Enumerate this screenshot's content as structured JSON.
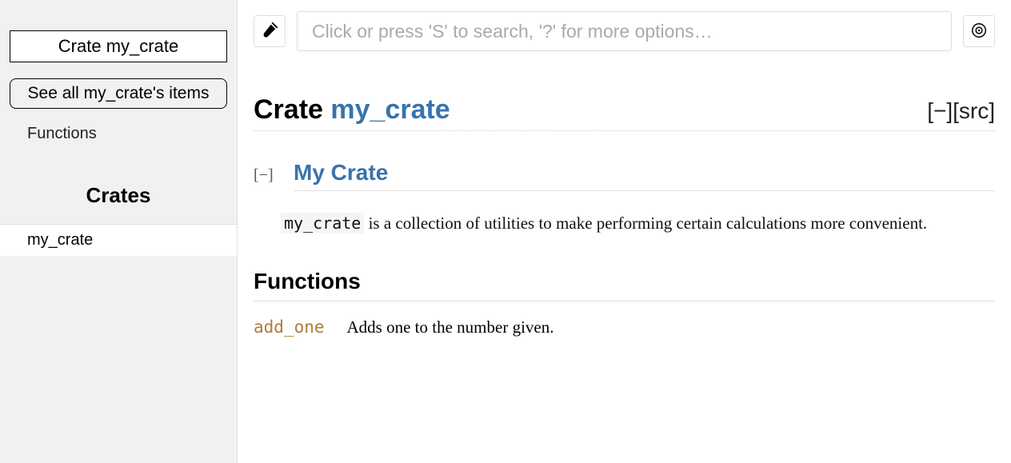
{
  "sidebar": {
    "badge": "Crate my_crate",
    "see_all": "See all my_crate's items",
    "nav": {
      "functions": "Functions"
    },
    "crates_heading": "Crates",
    "crates": [
      "my_crate"
    ]
  },
  "topbar": {
    "search_placeholder": "Click or press 'S' to search, '?' for more options…"
  },
  "page": {
    "title_prefix": "Crate ",
    "title_name": "my_crate",
    "collapse_label": "[−]",
    "src_label": "[src]"
  },
  "doc": {
    "collapse_small": "[−]",
    "heading": "My Crate",
    "code": "my_crate",
    "para_rest": " is a collection of utilities to make performing certain calculations more convenient."
  },
  "sections": {
    "functions_heading": "Functions",
    "functions": [
      {
        "name": "add_one",
        "desc": "Adds one to the number given."
      }
    ]
  }
}
